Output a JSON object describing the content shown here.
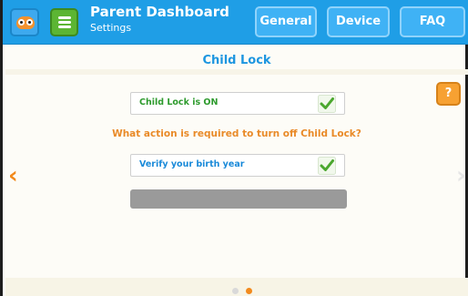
{
  "header": {
    "title": "Parent Dashboard",
    "subtitle": "Settings",
    "tabs": [
      {
        "label": "General"
      },
      {
        "label": "Device"
      },
      {
        "label": "FAQ"
      }
    ]
  },
  "main": {
    "section_title": "Child Lock",
    "status_field": "Child Lock is ON",
    "question": "What action is required to turn off Child Lock?",
    "action_field": "Verify your birth year",
    "help_label": "?",
    "nav_left": "‹",
    "nav_right": "›"
  },
  "pagination": {
    "current": 2,
    "total": 2
  },
  "colors": {
    "header": "#1f9ee6",
    "accent_orange": "#f28a1d",
    "status_green": "#2e9b2e",
    "action_blue": "#1a8ad9"
  }
}
